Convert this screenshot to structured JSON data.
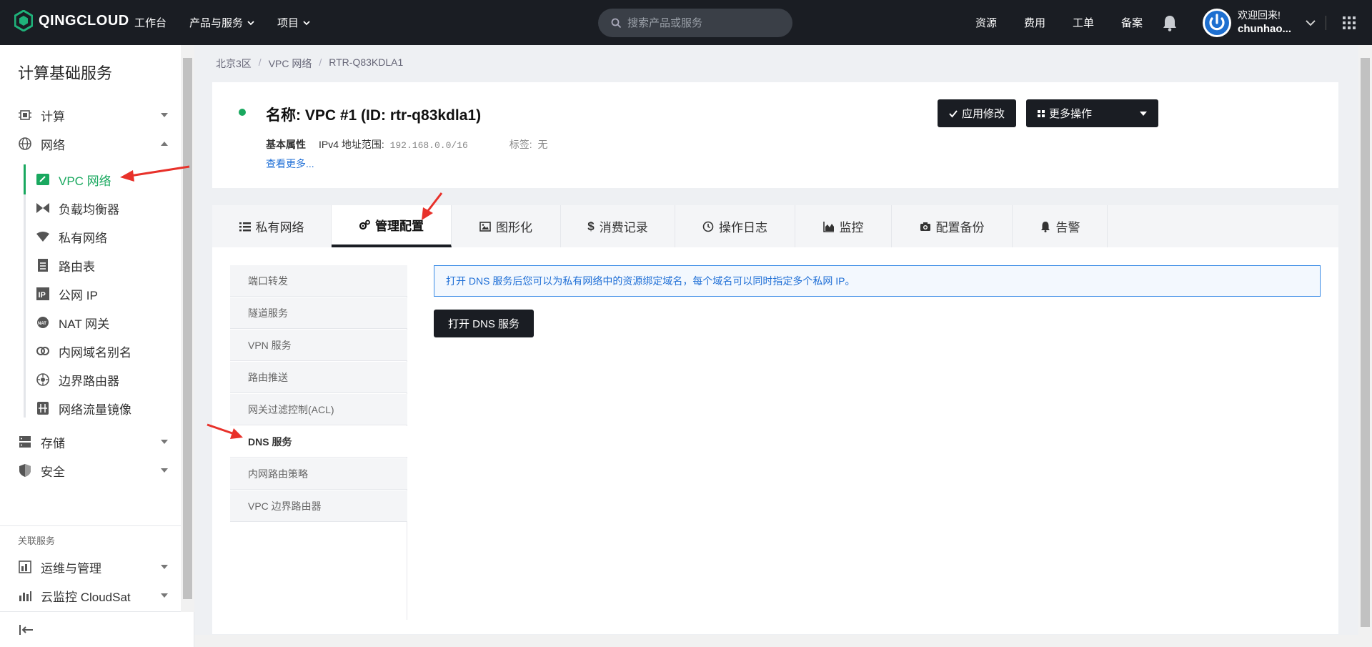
{
  "header": {
    "logo_text": "QINGCLOUD",
    "nav": [
      "工作台",
      "产品与服务",
      "项目"
    ],
    "search_placeholder": "搜索产品或服务",
    "right_links": [
      "资源",
      "费用",
      "工单",
      "备案"
    ],
    "welcome": "欢迎回来!",
    "username": "chunhao..."
  },
  "sidebar": {
    "title": "计算基础服务",
    "groups": {
      "compute": "计算",
      "network": "网络",
      "storage": "存储",
      "security": "安全"
    },
    "network_items": [
      "VPC 网络",
      "负载均衡器",
      "私有网络",
      "路由表",
      "公网 IP",
      "NAT 网关",
      "内网域名别名",
      "边界路由器",
      "网络流量镜像"
    ],
    "related_title": "关联服务",
    "related": [
      "运维与管理",
      "云监控 CloudSat"
    ]
  },
  "breadcrumb": [
    "北京3区",
    "VPC 网络",
    "RTR-Q83KDLA1"
  ],
  "resource": {
    "name": "名称: VPC #1 (ID: rtr-q83kdla1)",
    "basic_label": "基本属性",
    "ipv4_label": "IPv4 地址范围:",
    "ipv4_value": "192.168.0.0/16",
    "tag_label": "标签:",
    "tag_value": "无",
    "see_more": "查看更多...",
    "apply_button": "应用修改",
    "more_button": "更多操作"
  },
  "tabs": [
    "私有网络",
    "管理配置",
    "图形化",
    "消费记录",
    "操作日志",
    "监控",
    "配置备份",
    "告警"
  ],
  "active_tab": "管理配置",
  "submenu": [
    "端口转发",
    "隧道服务",
    "VPN 服务",
    "路由推送",
    "网关过滤控制(ACL)",
    "DNS 服务",
    "内网路由策略",
    "VPC 边界路由器"
  ],
  "active_submenu": "DNS 服务",
  "notice": "打开 DNS 服务后您可以为私有网络中的资源绑定域名，每个域名可以同时指定多个私网 IP。",
  "open_dns_button": "打开 DNS 服务",
  "colors": {
    "accent_green": "#19a85f",
    "dark": "#1a1d23",
    "link_blue": "#1f6fd6",
    "annotation_red": "#e8312a"
  }
}
